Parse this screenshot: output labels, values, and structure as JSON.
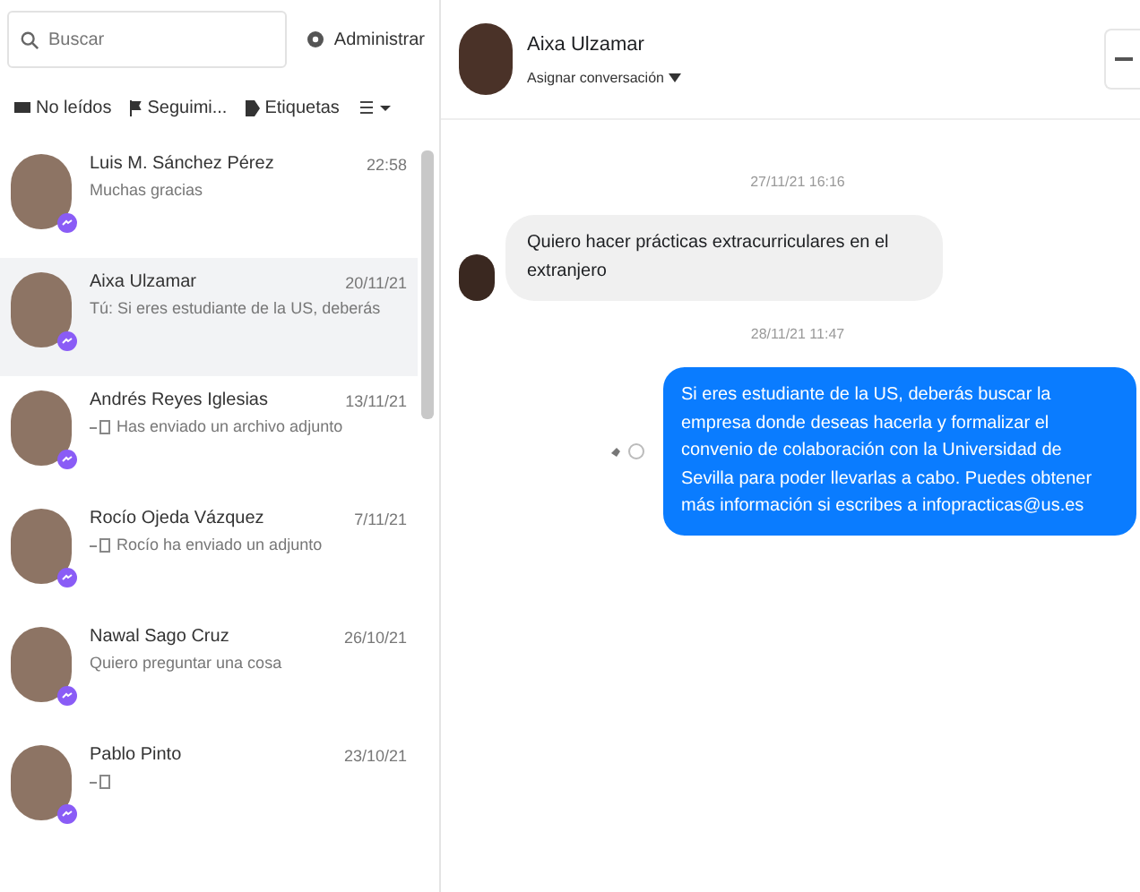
{
  "search": {
    "placeholder": "Buscar"
  },
  "manage_button": {
    "label": "Administrar"
  },
  "filters": [
    {
      "label": "No leídos"
    },
    {
      "label": "Seguimi..."
    },
    {
      "label": "Etiquetas"
    }
  ],
  "conversations": [
    {
      "name": "Luis M. Sánchez Pérez",
      "time": "22:58",
      "preview": "Muchas gracias",
      "selected": false,
      "attachment": false
    },
    {
      "name": "Aixa Ulzamar",
      "time": "20/11/21",
      "preview": "Tú: Si eres estudiante de la US, deberás",
      "selected": true,
      "attachment": false
    },
    {
      "name": "Andrés Reyes Iglesias",
      "time": "13/11/21",
      "preview": "Has enviado un archivo adjunto",
      "selected": false,
      "attachment": true
    },
    {
      "name": "Rocío Ojeda Vázquez",
      "time": "7/11/21",
      "preview": "Rocío ha enviado un adjunto",
      "selected": false,
      "attachment": true
    },
    {
      "name": "Nawal Sago Cruz",
      "time": "26/10/21",
      "preview": "Quiero preguntar una cosa",
      "selected": false,
      "attachment": false
    },
    {
      "name": "Pablo Pinto",
      "time": "23/10/21",
      "selected": false,
      "attachment": true
    }
  ],
  "chat": {
    "name": "Aixa Ulzamar",
    "subtitle": "Asignar conversación",
    "messages": [
      {
        "kind": "timestamp",
        "text": "27/11/21 16:16"
      },
      {
        "kind": "incoming",
        "text": "Quiero hacer prácticas extracurriculares en el extranjero"
      },
      {
        "kind": "timestamp",
        "text": "28/11/21 11:47"
      },
      {
        "kind": "outgoing",
        "text": "Si eres estudiante de la US, deberás buscar la empresa donde deseas hacerla y formalizar el convenio de colaboración con la Universidad de Sevilla para poder llevarlas a cabo. Puedes obtener más información si escribes a infopracticas@us.es"
      }
    ]
  }
}
